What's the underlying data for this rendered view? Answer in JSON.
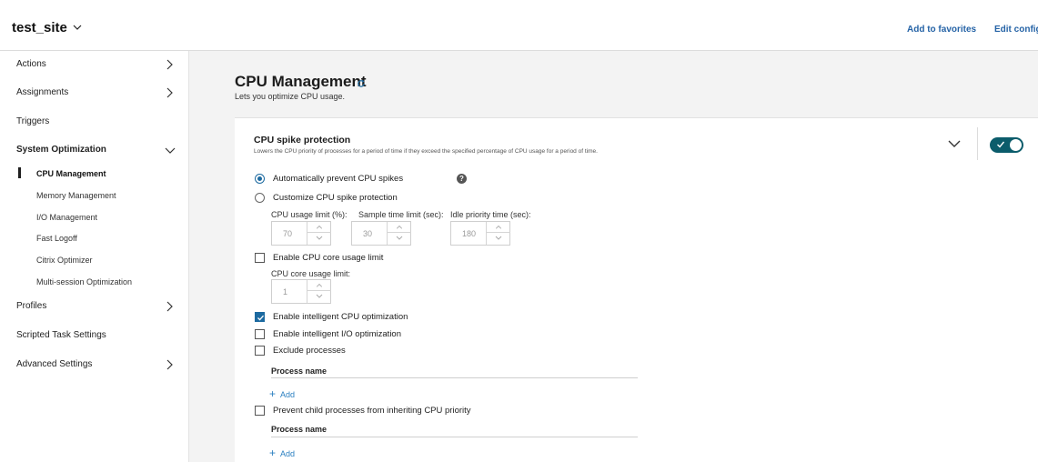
{
  "header": {
    "site_name": "test_site",
    "site_dropdown_icon": "chevron-down-icon",
    "add_favorites": "Add to favorites",
    "edit_config": "Edit configu"
  },
  "sidebar": {
    "items": [
      {
        "label": "Actions",
        "expandable": true,
        "expanded": false
      },
      {
        "label": "Assignments",
        "expandable": true,
        "expanded": false
      },
      {
        "label": "Triggers",
        "expandable": false
      },
      {
        "label": "System Optimization",
        "expandable": true,
        "expanded": true
      },
      {
        "label": "Profiles",
        "expandable": true,
        "expanded": false
      },
      {
        "label": "Scripted Task Settings",
        "expandable": false
      },
      {
        "label": "Advanced Settings",
        "expandable": true,
        "expanded": false
      }
    ],
    "sub_items": [
      {
        "label": "CPU Management",
        "active": true
      },
      {
        "label": "Memory Management"
      },
      {
        "label": "I/O Management"
      },
      {
        "label": "Fast Logoff"
      },
      {
        "label": "Citrix Optimizer"
      },
      {
        "label": "Multi-session Optimization"
      }
    ]
  },
  "main": {
    "title": "CPU Management",
    "description": "Lets you optimize CPU usage.",
    "card": {
      "title": "CPU spike protection",
      "description": "Lowers the CPU priority of processes for a period of time if they exceed the specified percentage of CPU usage for a period of time.",
      "enabled": true,
      "radio_auto": "Automatically prevent CPU spikes",
      "radio_auto_selected": true,
      "help_symbol": "?",
      "radio_custom": "Customize CPU spike protection",
      "cpu_limit_label": "CPU usage limit (%):",
      "cpu_limit_value": "70",
      "sample_time_label": "Sample time limit (sec):",
      "sample_time_value": "30",
      "idle_priority_label": "Idle priority time (sec):",
      "idle_priority_value": "180",
      "core_limit_checkbox": "Enable CPU core usage limit",
      "core_limit_checked": false,
      "core_limit_label": "CPU core usage limit:",
      "core_limit_value": "1",
      "intelligent_cpu": "Enable intelligent CPU optimization",
      "intelligent_cpu_checked": true,
      "intelligent_io": "Enable intelligent I/O optimization",
      "intelligent_io_checked": false,
      "exclude_processes": "Exclude processes",
      "exclude_processes_checked": false,
      "process_name_header": "Process name",
      "add_label": "Add",
      "prevent_child": "Prevent child processes from inheriting CPU priority",
      "prevent_child_checked": false,
      "process_name_header_2": "Process name",
      "add_label_2": "Add"
    }
  },
  "colors": {
    "toggle_on": "#0b5c6b",
    "accent": "#1d6aa0",
    "link": "#2a7fc0"
  }
}
